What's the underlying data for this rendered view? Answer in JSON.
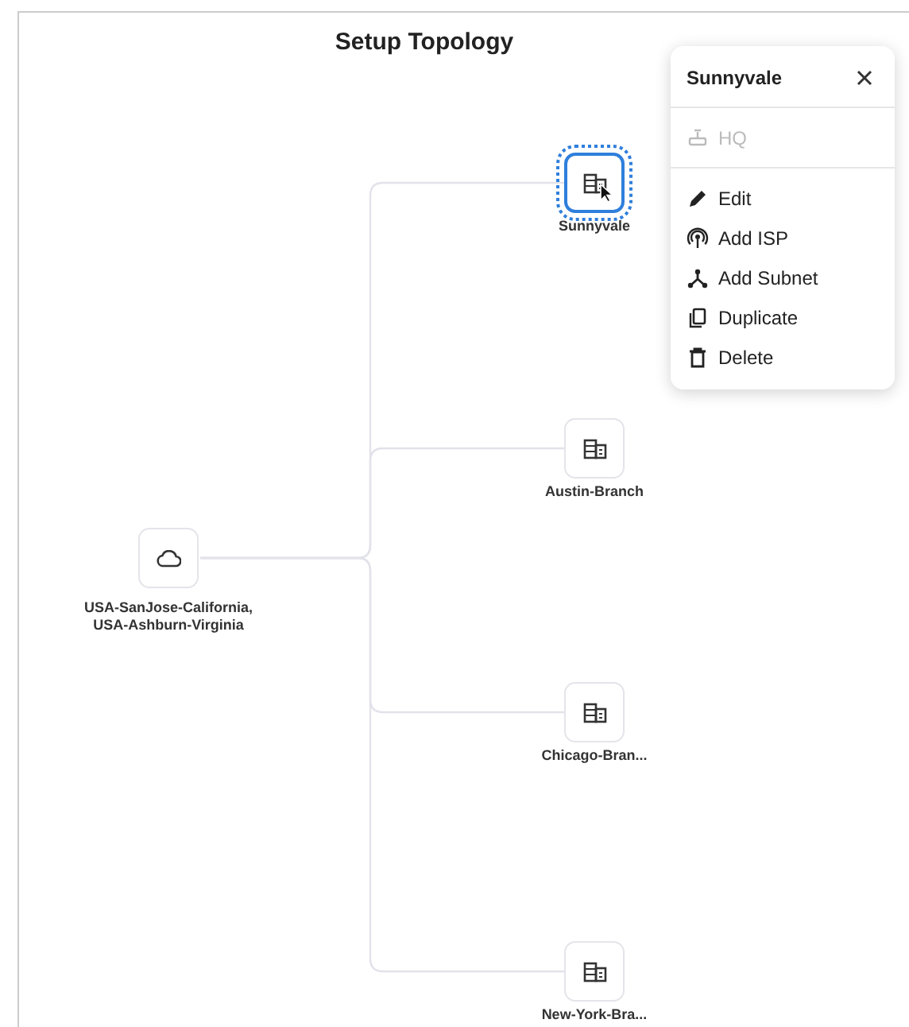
{
  "title": "Setup Topology",
  "hub": {
    "label_lines": [
      "USA-SanJose-California,",
      "USA-Ashburn-Virginia"
    ]
  },
  "branches": [
    {
      "label": "Sunnyvale",
      "selected": true
    },
    {
      "label": "Austin-Branch",
      "selected": false
    },
    {
      "label": "Chicago-Bran...",
      "selected": false
    },
    {
      "label": "New-York-Bra...",
      "selected": false
    }
  ],
  "menu": {
    "title": "Sunnyvale",
    "sections": [
      [
        {
          "label": "HQ",
          "disabled": true
        }
      ],
      [
        {
          "label": "Edit",
          "disabled": false
        },
        {
          "label": "Add ISP",
          "disabled": false
        },
        {
          "label": "Add Subnet",
          "disabled": false
        },
        {
          "label": "Duplicate",
          "disabled": false
        },
        {
          "label": "Delete",
          "disabled": false
        }
      ]
    ]
  }
}
